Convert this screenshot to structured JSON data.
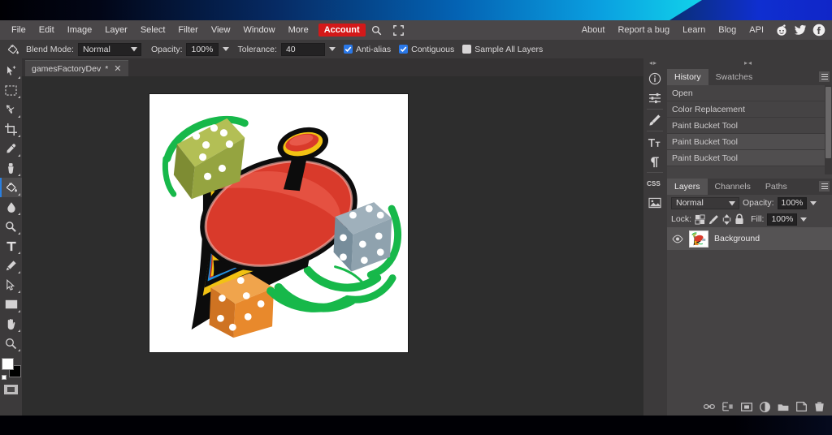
{
  "app": {
    "title": "Photopea-like image editor",
    "menu": [
      "File",
      "Edit",
      "Image",
      "Layer",
      "Select",
      "Filter",
      "View",
      "Window",
      "More"
    ],
    "account_label": "Account",
    "search_icon": "search-icon",
    "fullscreen_icon": "fullscreen-icon",
    "menu_right": [
      "About",
      "Report a bug",
      "Learn",
      "Blog",
      "API"
    ],
    "social": [
      "reddit-icon",
      "twitter-icon",
      "facebook-icon"
    ],
    "accent_red": "#d31919",
    "accent_blue": "#2a78e8"
  },
  "options_bar": {
    "tool_icon": "paint-bucket-icon",
    "blend_mode_label": "Blend Mode:",
    "blend_mode_value": "Normal",
    "opacity_label": "Opacity:",
    "opacity_value": "100%",
    "tolerance_label": "Tolerance:",
    "tolerance_value": "40",
    "antialias_label": "Anti-alias",
    "antialias_checked": true,
    "contiguous_label": "Contiguous",
    "contiguous_checked": true,
    "sample_all_label": "Sample All Layers",
    "sample_all_checked": false
  },
  "toolbar": {
    "tools": [
      {
        "name": "move-tool",
        "glyph": "move"
      },
      {
        "name": "rectangular-marquee-tool",
        "glyph": "marquee"
      },
      {
        "name": "lasso-tool",
        "glyph": "lasso"
      },
      {
        "name": "crop-tool",
        "glyph": "crop"
      },
      {
        "name": "eyedropper-tool",
        "glyph": "eyedropper"
      },
      {
        "name": "spot-healing-brush-tool",
        "glyph": "heal"
      },
      {
        "name": "paint-bucket-tool",
        "glyph": "bucket",
        "selected": true
      },
      {
        "name": "blur-tool",
        "glyph": "blur"
      },
      {
        "name": "dodge-tool",
        "glyph": "dodge"
      },
      {
        "name": "type-tool",
        "glyph": "type"
      },
      {
        "name": "pen-tool",
        "glyph": "pen"
      },
      {
        "name": "path-select-tool",
        "glyph": "pathselect"
      },
      {
        "name": "shape-tool",
        "glyph": "shape"
      },
      {
        "name": "hand-tool",
        "glyph": "hand"
      },
      {
        "name": "zoom-tool",
        "glyph": "zoom"
      }
    ],
    "foreground_color": "#ffffff",
    "background_color": "#000000",
    "quickmask_label": "quick-mask-toggle"
  },
  "document": {
    "tab_name": "gamesFactoryDev",
    "modified_marker": "*",
    "close_label": "✕",
    "canvas_alt": "spinning top with dice and green swirls on white background"
  },
  "dock": {
    "icons": [
      "info-icon",
      "adjustments-icon",
      "brush-icon",
      "character-icon",
      "paragraph-icon",
      "css-icon",
      "image-icon"
    ],
    "collapse_left": "◂▸",
    "collapse_right": "▸◂"
  },
  "history_panel": {
    "tabs": [
      {
        "label": "History",
        "active": true
      },
      {
        "label": "Swatches",
        "active": false
      }
    ],
    "menu_icon": "panel-menu-icon",
    "items": [
      {
        "label": "Open",
        "highlighted": false
      },
      {
        "label": "Color Replacement",
        "highlighted": false
      },
      {
        "label": "Paint Bucket Tool",
        "highlighted": false
      },
      {
        "label": "Paint Bucket Tool",
        "highlighted": true
      },
      {
        "label": "Paint Bucket Tool",
        "highlighted": true
      }
    ]
  },
  "layers_panel": {
    "tabs": [
      {
        "label": "Layers",
        "active": true
      },
      {
        "label": "Channels",
        "active": false
      },
      {
        "label": "Paths",
        "active": false
      }
    ],
    "menu_icon": "panel-menu-icon",
    "blend_mode_value": "Normal",
    "opacity_label": "Opacity:",
    "opacity_value": "100%",
    "lock_label": "Lock:",
    "lock_icons": [
      "lock-transparency-icon",
      "lock-paint-icon",
      "lock-move-icon",
      "lock-all-icon"
    ],
    "fill_label": "Fill:",
    "fill_value": "100%",
    "layers": [
      {
        "name": "Background",
        "visible": true,
        "selected": true
      }
    ],
    "bottom_icons": [
      "link-layers-icon",
      "layer-style-icon",
      "add-mask-icon",
      "adjustment-layer-icon",
      "new-group-icon",
      "new-layer-icon",
      "delete-layer-icon"
    ]
  }
}
